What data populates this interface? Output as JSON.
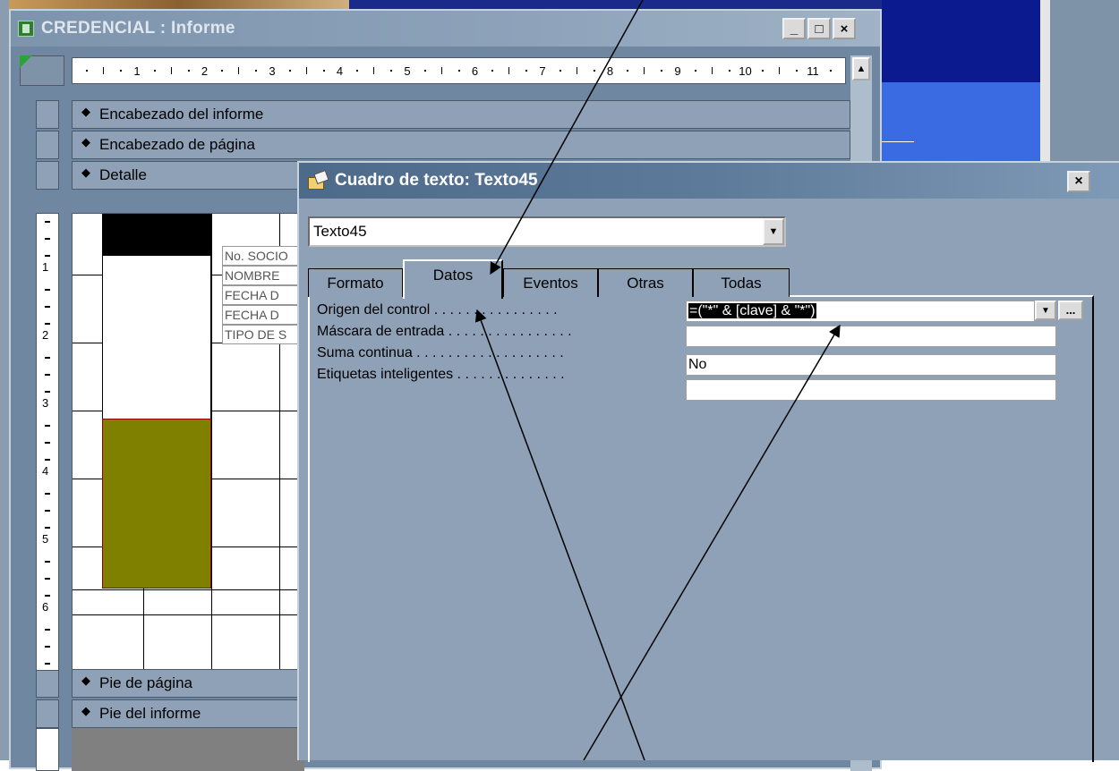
{
  "report_window": {
    "title": "CREDENCIAL : Informe",
    "min_label": "_",
    "max_label": "□",
    "close_label": "×"
  },
  "ruler": {
    "h_numbers": [
      "1",
      "2",
      "3",
      "4",
      "5",
      "6",
      "7",
      "8",
      "9",
      "10",
      "11"
    ],
    "v_numbers": [
      "1",
      "2",
      "3",
      "4",
      "5",
      "6"
    ]
  },
  "sections": {
    "report_header": "Encabezado del informe",
    "page_header": "Encabezado de página",
    "detail": "Detalle",
    "page_footer": "Pie de página",
    "report_footer": "Pie del informe"
  },
  "detail_labels": [
    "No. SOCIO",
    "NOMBRE",
    "FECHA D",
    "FECHA D",
    "TIPO DE S"
  ],
  "property_sheet": {
    "title": "Cuadro de texto: Texto45",
    "close_label": "×",
    "object_selected": "Texto45",
    "tabs": [
      "Formato",
      "Datos",
      "Eventos",
      "Otras",
      "Todas"
    ],
    "active_tab": "Datos",
    "properties": [
      {
        "name": "Origen del control",
        "dots": " . . . . . . . . . . . . . . . .",
        "value": "=(\"*\" & [clave] & \"*\")"
      },
      {
        "name": "Máscara de entrada",
        "dots": " . . . . . . . . . . . . . . . .",
        "value": ""
      },
      {
        "name": "Suma continua",
        "dots": " . . . . . . . . . . . . . . . . . . .",
        "value": "No"
      },
      {
        "name": "Etiquetas inteligentes",
        "dots": " . . . . . . . . . . . . . .",
        "value": ""
      }
    ],
    "build_label": "..."
  },
  "colors": {
    "olive_block": "#808000",
    "titlebar_active": "#4d6a8a",
    "desktop_blue": "#3a6be2"
  }
}
